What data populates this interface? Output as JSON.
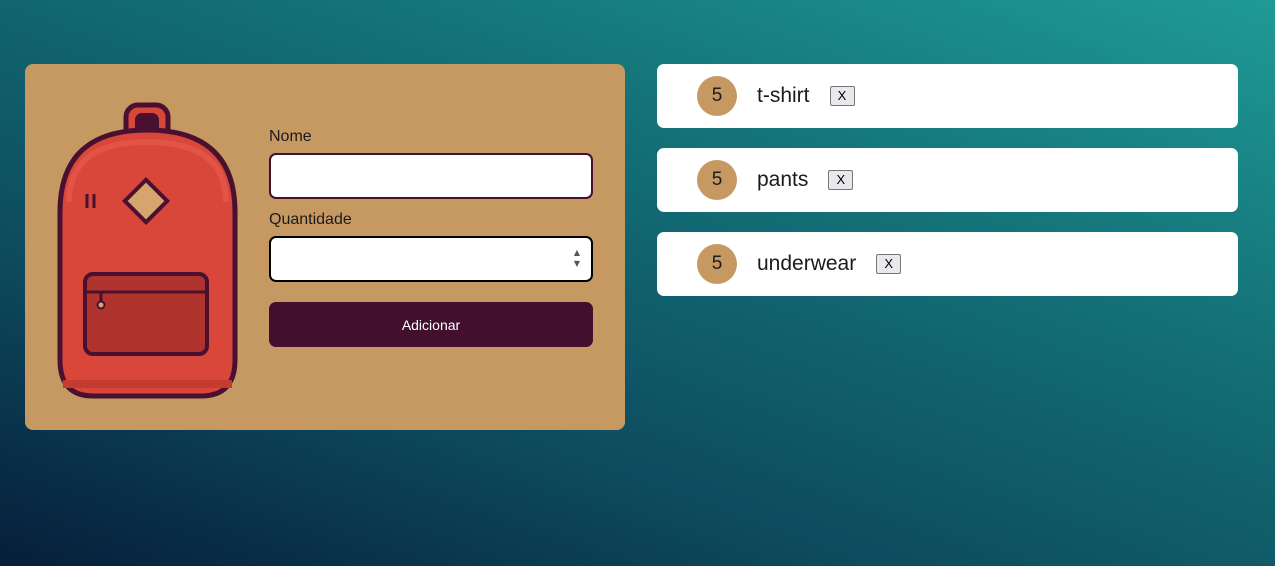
{
  "form": {
    "name_label": "Nome",
    "name_value": "",
    "quantity_label": "Quantidade",
    "quantity_value": "",
    "submit_label": "Adicionar"
  },
  "items": [
    {
      "quantity": "5",
      "name": "t-shirt",
      "remove_label": "X"
    },
    {
      "quantity": "5",
      "name": "pants",
      "remove_label": "X"
    },
    {
      "quantity": "5",
      "name": "underwear",
      "remove_label": "X"
    }
  ],
  "colors": {
    "card_background": "#c69963",
    "button_background": "#42102e",
    "backpack_body": "#d9463a",
    "backpack_outline": "#4a1030"
  },
  "icons": {
    "illustration": "backpack-icon"
  }
}
